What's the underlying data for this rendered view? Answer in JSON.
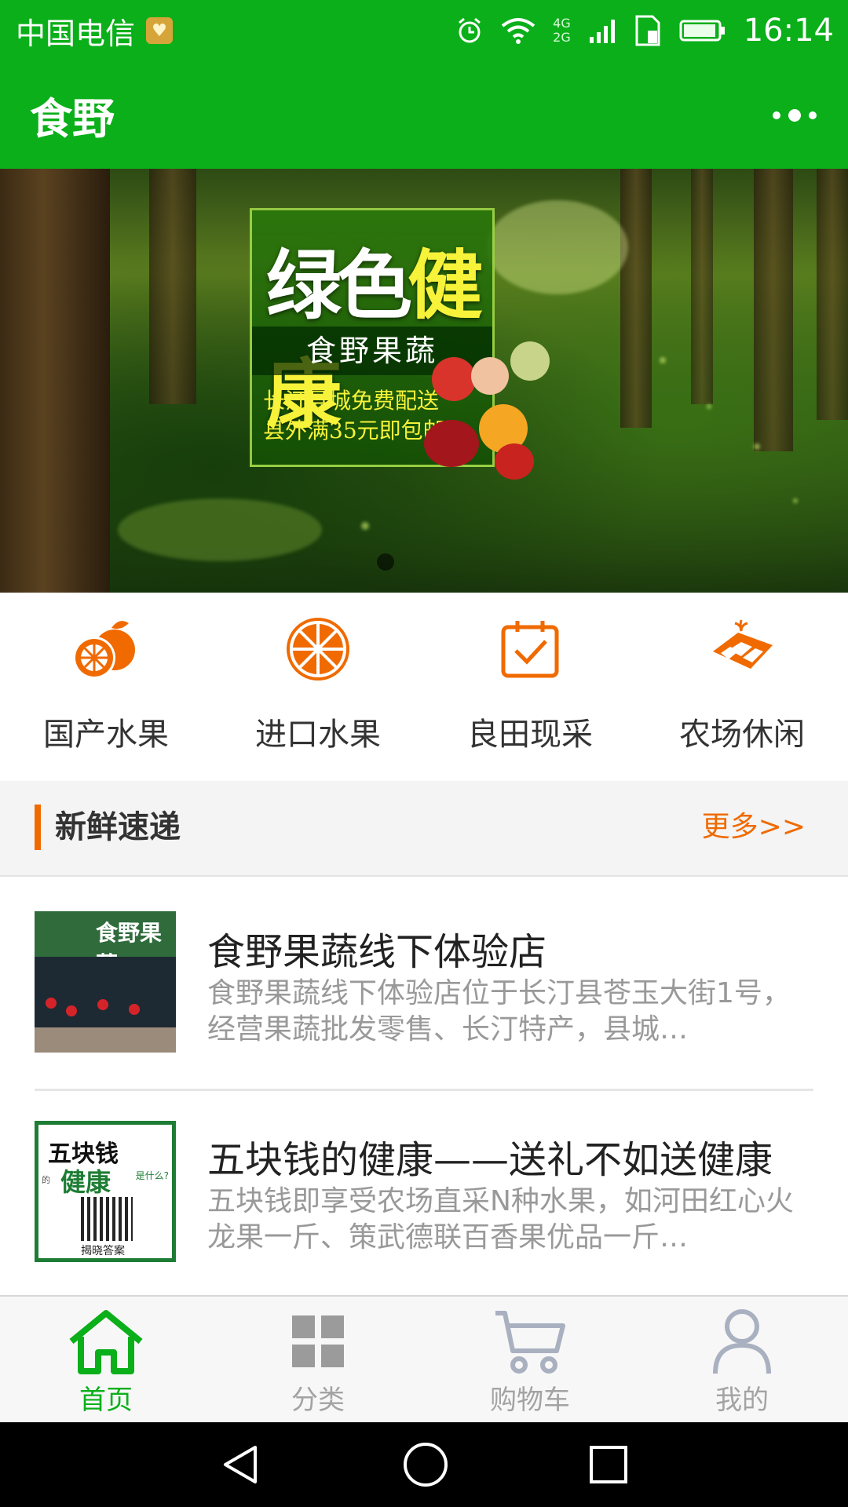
{
  "status_bar": {
    "carrier": "中国电信",
    "network_top": "4G",
    "network_bottom": "2G",
    "time": "16:14"
  },
  "title_bar": {
    "title": "食野"
  },
  "banner": {
    "headline_white": "绿色",
    "headline_yellow": "健康",
    "subtitle": "食野果蔬",
    "promo_line1": "长汀县城免费配送",
    "promo_line2": "县外满35元即包邮"
  },
  "categories": [
    {
      "label": "国产水果",
      "icon": "orange-icon"
    },
    {
      "label": "进口水果",
      "icon": "orange-slice-icon"
    },
    {
      "label": "良田现采",
      "icon": "calendar-check-icon"
    },
    {
      "label": "农场休闲",
      "icon": "farm-field-icon"
    }
  ],
  "section": {
    "title": "新鲜速递",
    "more": "更多>>"
  },
  "articles": [
    {
      "title": "食野果蔬线下体验店",
      "desc": "食野果蔬线下体验店位于长汀县苍玉大街1号，经营果蔬批发零售、长汀特产，县城…",
      "thumb_sign": "食野果蔬"
    },
    {
      "title": "五块钱的健康——送礼不如送健康",
      "desc": "五块钱即享受农场直采N种水果，如河田红心火龙果一斤、策武德联百香果优品一斤…",
      "poster_line1": "五块钱",
      "poster_line2": "健康",
      "poster_small_left": "的",
      "poster_small_right": "是什么?",
      "poster_bottom": "揭晓答案"
    }
  ],
  "tabs": [
    {
      "label": "首页",
      "icon": "home-icon",
      "active": true
    },
    {
      "label": "分类",
      "icon": "grid-icon",
      "active": false
    },
    {
      "label": "购物车",
      "icon": "cart-icon",
      "active": false
    },
    {
      "label": "我的",
      "icon": "user-icon",
      "active": false
    }
  ],
  "colors": {
    "primary_green": "#0aaf19",
    "accent_orange": "#f06a00"
  }
}
